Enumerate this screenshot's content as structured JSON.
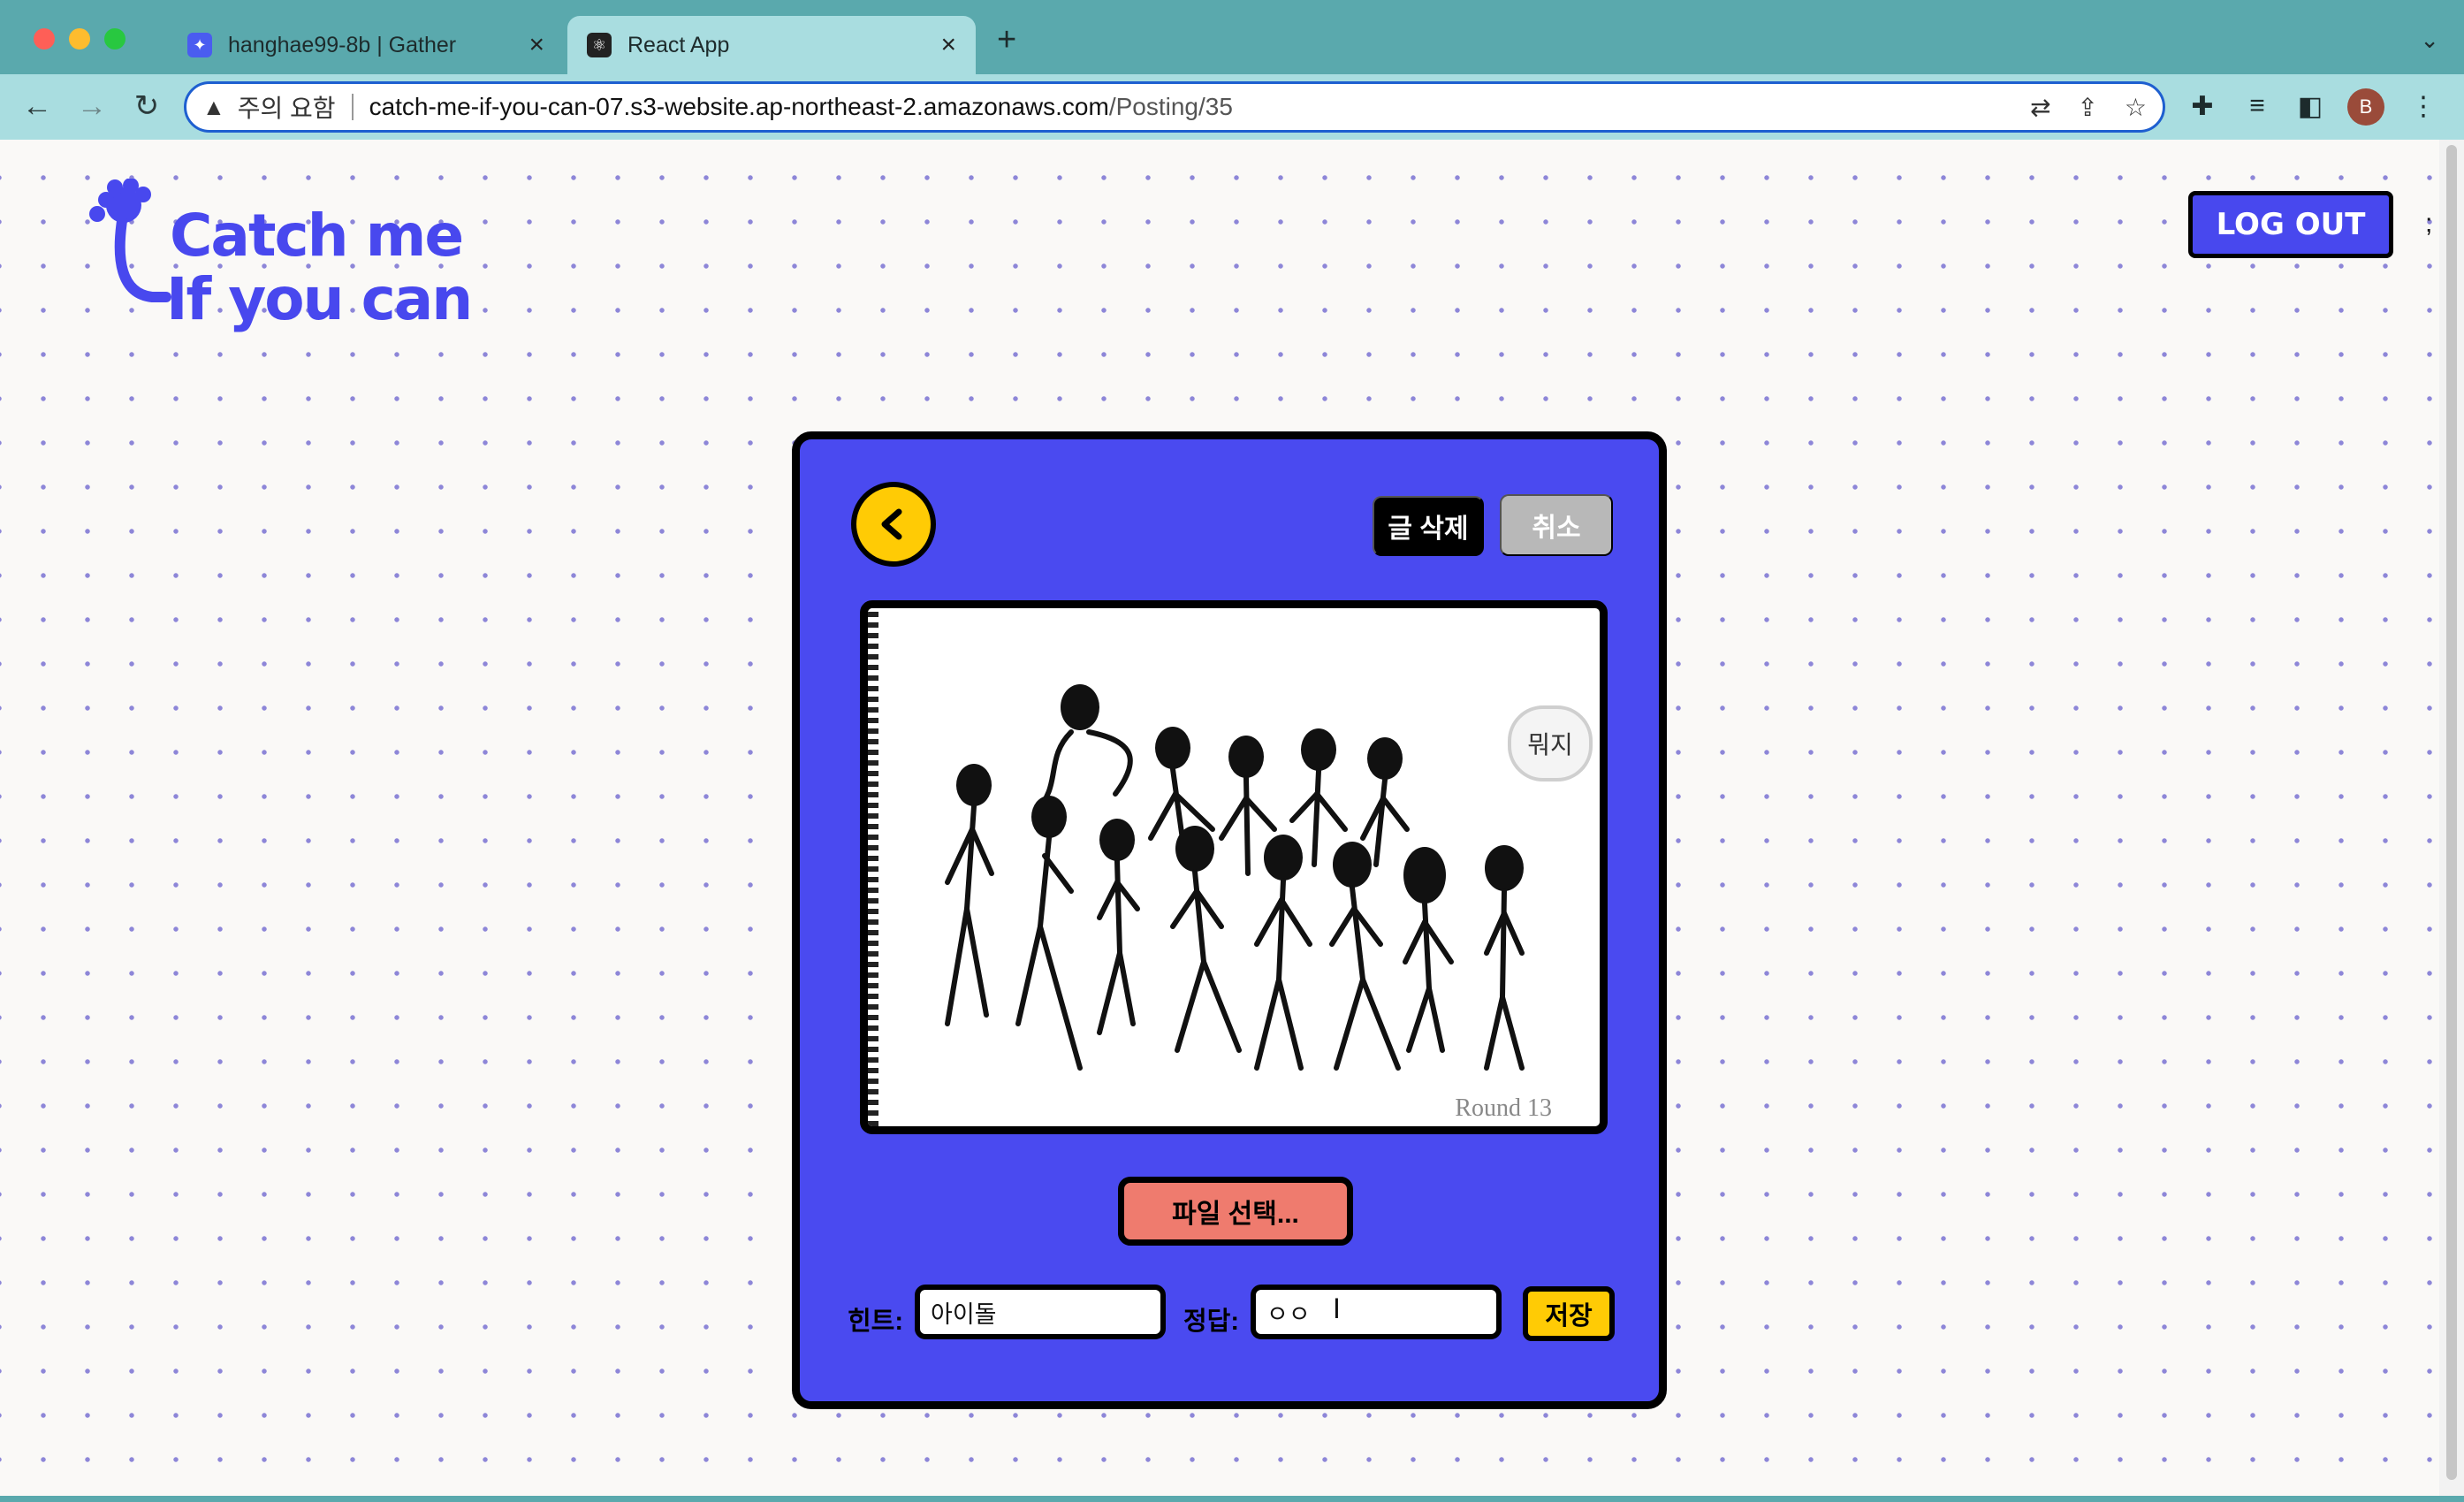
{
  "browser": {
    "tabs": [
      {
        "title": "hanghae99-8b | Gather",
        "active": false,
        "icon": "gather-icon"
      },
      {
        "title": "React App",
        "active": true,
        "icon": "react-icon"
      }
    ],
    "address": {
      "warning_label": "주의 요함",
      "host": "catch-me-if-you-can-07.s3-website.ap-northeast-2.amazonaws.com",
      "path": "/Posting/35"
    },
    "profile_initial": "B"
  },
  "header": {
    "logo_line1": "Catch me",
    "logo_line2": "If you can",
    "logout_label": "LOG OUT",
    "overflow_char": ";"
  },
  "card": {
    "delete_label": "글 삭제",
    "cancel_label": "취소",
    "image": {
      "bubble_text": "뭐지",
      "round_text": "Round 13"
    },
    "file_button_label": "파일 선택...",
    "hint_label": "힌트:",
    "hint_value": "아이돌",
    "answer_label": "정답:",
    "answer_value": "ㅇㅇ",
    "save_label": "저장"
  },
  "colors": {
    "brand": "#4848ee",
    "accent_yellow": "#ffcb05",
    "file_button": "#ef7b6e",
    "browser_chrome": "#5aa9ad"
  }
}
